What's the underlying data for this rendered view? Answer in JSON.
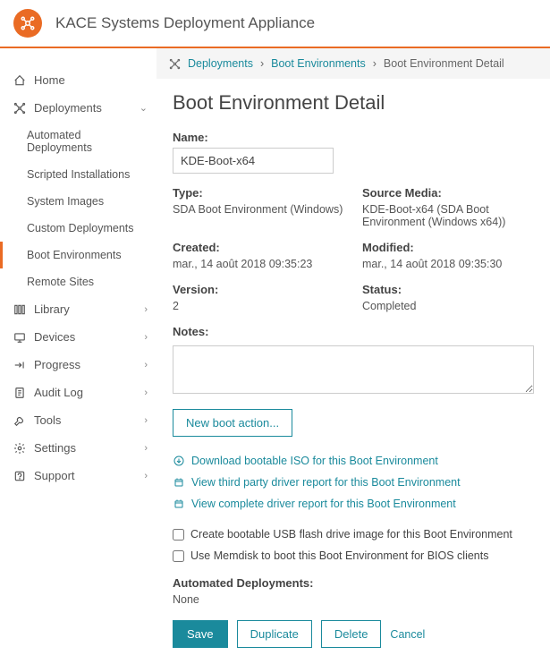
{
  "header": {
    "app_title": "KACE Systems Deployment Appliance"
  },
  "sidebar": {
    "items": [
      {
        "label": "Home"
      },
      {
        "label": "Deployments",
        "expanded": true,
        "children": [
          {
            "label": "Automated Deployments"
          },
          {
            "label": "Scripted Installations"
          },
          {
            "label": "System Images"
          },
          {
            "label": "Custom Deployments"
          },
          {
            "label": "Boot Environments",
            "active": true
          },
          {
            "label": "Remote Sites"
          }
        ]
      },
      {
        "label": "Library"
      },
      {
        "label": "Devices"
      },
      {
        "label": "Progress"
      },
      {
        "label": "Audit Log"
      },
      {
        "label": "Tools"
      },
      {
        "label": "Settings"
      },
      {
        "label": "Support"
      }
    ]
  },
  "breadcrumb": {
    "items": [
      "Deployments",
      "Boot Environments",
      "Boot Environment Detail"
    ]
  },
  "page": {
    "title": "Boot Environment Detail",
    "name_label": "Name:",
    "name_value": "KDE-Boot-x64",
    "type_label": "Type:",
    "type_value": "SDA Boot Environment (Windows)",
    "source_label": "Source Media:",
    "source_value": "KDE-Boot-x64 (SDA Boot Environment (Windows x64))",
    "created_label": "Created:",
    "created_value": "mar., 14 août 2018 09:35:23",
    "modified_label": "Modified:",
    "modified_value": "mar., 14 août 2018 09:35:30",
    "version_label": "Version:",
    "version_value": "2",
    "status_label": "Status:",
    "status_value": "Completed",
    "notes_label": "Notes:",
    "notes_value": "",
    "new_boot_action": "New boot action...",
    "links": [
      "Download bootable ISO for this Boot Environment",
      "View third party driver report for this Boot Environment",
      "View complete driver report for this Boot Environment"
    ],
    "checkboxes": [
      "Create bootable USB flash drive image for this Boot Environment",
      "Use Memdisk to boot this Boot Environment for BIOS clients"
    ],
    "auto_dep_label": "Automated Deployments:",
    "auto_dep_value": "None",
    "save": "Save",
    "duplicate": "Duplicate",
    "delete": "Delete",
    "cancel": "Cancel"
  }
}
